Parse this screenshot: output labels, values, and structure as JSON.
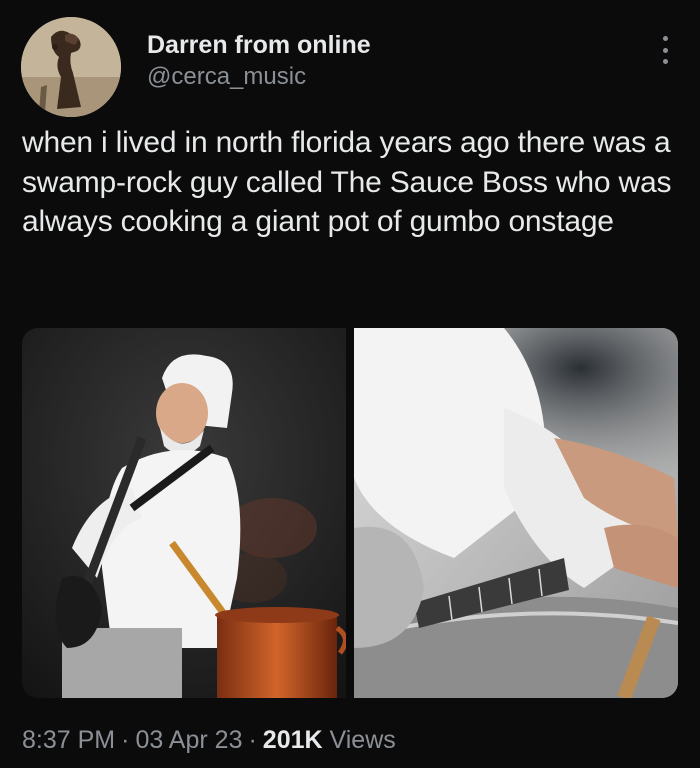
{
  "author": {
    "display_name": "Darren from online",
    "handle": "@cerca_music"
  },
  "tweet": {
    "text": "when i lived in north florida years ago there was a swamp-rock guy called The Sauce Boss who was always cooking a giant pot of gumbo onstage"
  },
  "media": [
    {
      "icon": "photo-performer-guitar-chef-hat"
    },
    {
      "icon": "photo-guitar-in-pot"
    }
  ],
  "meta": {
    "time": "8:37 PM",
    "separator": "·",
    "date": "03 Apr 23",
    "views_count": "201K",
    "views_label": "Views"
  },
  "colors": {
    "background": "#0b0b0b",
    "primary_text": "#e7e9ea",
    "secondary_text": "#8b9096"
  }
}
